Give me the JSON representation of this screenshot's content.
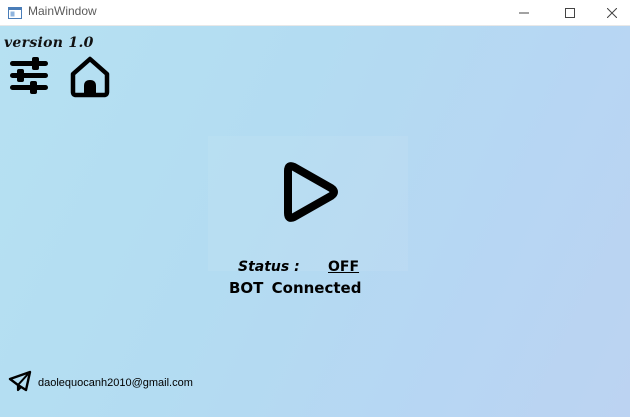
{
  "window": {
    "title": "MainWindow"
  },
  "header": {
    "version": "version 1.0"
  },
  "icons": {
    "settings": "sliders-icon",
    "home": "home-icon",
    "play": "play-icon",
    "contact": "telegram-icon"
  },
  "status": {
    "label": "Status :",
    "value": "OFF",
    "bot_text": "BOT Connected"
  },
  "footer": {
    "email": "daolequocanh2010@gmail.com"
  },
  "colors": {
    "background_start": "#b6e1f2",
    "background_end": "#bcd3f2",
    "icon": "#000000"
  }
}
